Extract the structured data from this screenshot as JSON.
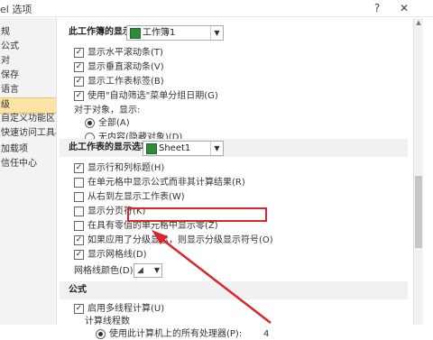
{
  "window": {
    "title": "el 选项",
    "help_glyph": "?",
    "close_glyph": "✕"
  },
  "sidebar": {
    "items": [
      {
        "label": "规"
      },
      {
        "label": "公式"
      },
      {
        "label": "对"
      },
      {
        "label": "保存"
      },
      {
        "label": "语言"
      },
      {
        "label": "级",
        "active": true
      },
      {
        "label": "自定义功能区"
      },
      {
        "label": "快速访问工具栏"
      },
      {
        "label": "加载项"
      },
      {
        "label": "信任中心"
      }
    ]
  },
  "workbook_section": {
    "heading": "此工作簿的显示选项(B):",
    "selected": "工作簿1",
    "options": [
      {
        "label": "显示水平滚动条(T)",
        "checked": true
      },
      {
        "label": "显示垂直滚动条(V)",
        "checked": true
      },
      {
        "label": "显示工作表标签(B)",
        "checked": true
      },
      {
        "label": "使用\"自动筛选\"菜单分组日期(G)",
        "checked": true
      }
    ],
    "objects_label": "对于对象，显示:",
    "radios": [
      {
        "label": "全部(A)",
        "selected": true
      },
      {
        "label": "无内容(隐藏对象)(D)",
        "selected": false
      }
    ]
  },
  "worksheet_section": {
    "heading": "此工作表的显示选项(S):",
    "selected": "Sheet1",
    "options": [
      {
        "label": "显示行和列标题(H)",
        "checked": true
      },
      {
        "label": "在单元格中显示公式而非其计算结果(R)",
        "checked": false
      },
      {
        "label": "从右到左显示工作表(W)",
        "checked": false
      },
      {
        "label": "显示分页符(K)",
        "checked": false
      },
      {
        "label": "在具有零值的单元格中显示零(Z)",
        "checked": false
      },
      {
        "label": "如果应用了分级显示，则显示分级显示符号(O)",
        "checked": true
      },
      {
        "label": "显示网格线(D)",
        "checked": true
      }
    ],
    "gridline_color_label": "网格线颜色(D)"
  },
  "formula_section": {
    "heading": "公式",
    "options": [
      {
        "label": "启用多线程计算(U)",
        "checked": true
      }
    ],
    "threads_label": "计算线程数",
    "threads_radio": {
      "label": "使用此计算机上的所有处理器(P):",
      "selected": true,
      "value": "4"
    }
  },
  "colors": {
    "highlight": "#d9252b",
    "active_nav": "#fce4a8",
    "arrow": "#d9252b"
  }
}
